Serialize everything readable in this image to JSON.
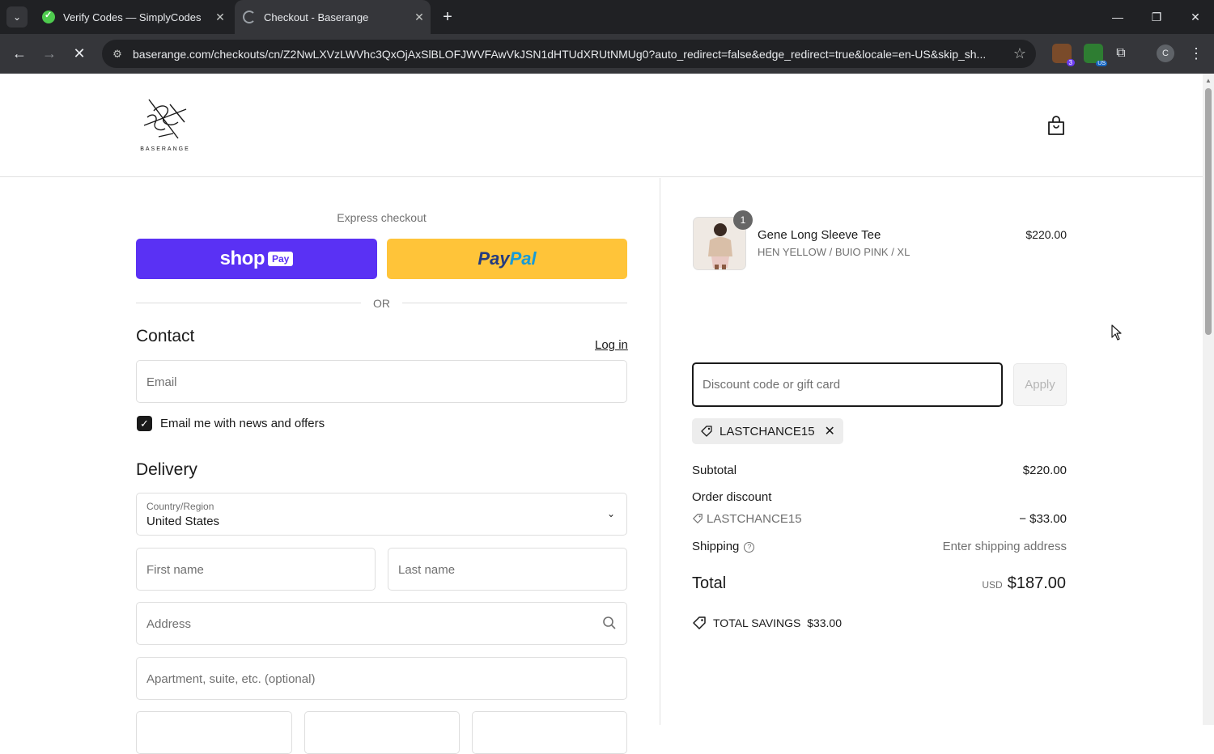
{
  "browser": {
    "tabs": [
      {
        "title": "Verify Codes — SimplyCodes",
        "active": false
      },
      {
        "title": "Checkout - Baserange",
        "active": true
      }
    ],
    "url": "baserange.com/checkouts/cn/Z2NwLXVzLWVhc3QxOjAxSlBLOFJWVFAwVkJSN1dHTUdXRUtNMUg0?auto_redirect=false&edge_redirect=true&locale=en-US&skip_sh...",
    "profile_initial": "C",
    "ext_badge_1": "3",
    "ext_badge_2": "US"
  },
  "header": {
    "logo_text": "BASERANGE"
  },
  "express": {
    "title": "Express checkout",
    "shoppay_word": "shop",
    "shoppay_chip": "Pay",
    "paypal_pay": "Pay",
    "paypal_pal": "Pal",
    "or_text": "OR"
  },
  "contact": {
    "heading": "Contact",
    "login_label": "Log in",
    "email_placeholder": "Email",
    "newsletter_label": "Email me with news and offers",
    "newsletter_checked": true
  },
  "delivery": {
    "heading": "Delivery",
    "country_label": "Country/Region",
    "country_value": "United States",
    "first_name_placeholder": "First name",
    "last_name_placeholder": "Last name",
    "address_placeholder": "Address",
    "apartment_placeholder": "Apartment, suite, etc. (optional)"
  },
  "order": {
    "item": {
      "name": "Gene Long Sleeve Tee",
      "variant": "HEN YELLOW / BUIO PINK / XL",
      "price": "$220.00",
      "quantity": "1"
    },
    "discount_placeholder": "Discount code or gift card",
    "apply_label": "Apply",
    "applied_code": "LASTCHANCE15",
    "subtotal_label": "Subtotal",
    "subtotal_value": "$220.00",
    "order_discount_label": "Order discount",
    "discount_code": "LASTCHANCE15",
    "discount_value": "− $33.00",
    "shipping_label": "Shipping",
    "shipping_value": "Enter shipping address",
    "total_label": "Total",
    "total_currency": "USD",
    "total_value": "$187.00",
    "savings_label": "TOTAL SAVINGS",
    "savings_value": "$33.00"
  },
  "colors": {
    "shoppay": "#5a31f4",
    "paypal": "#ffc439",
    "text": "#1a1a1a",
    "muted": "#707070"
  }
}
